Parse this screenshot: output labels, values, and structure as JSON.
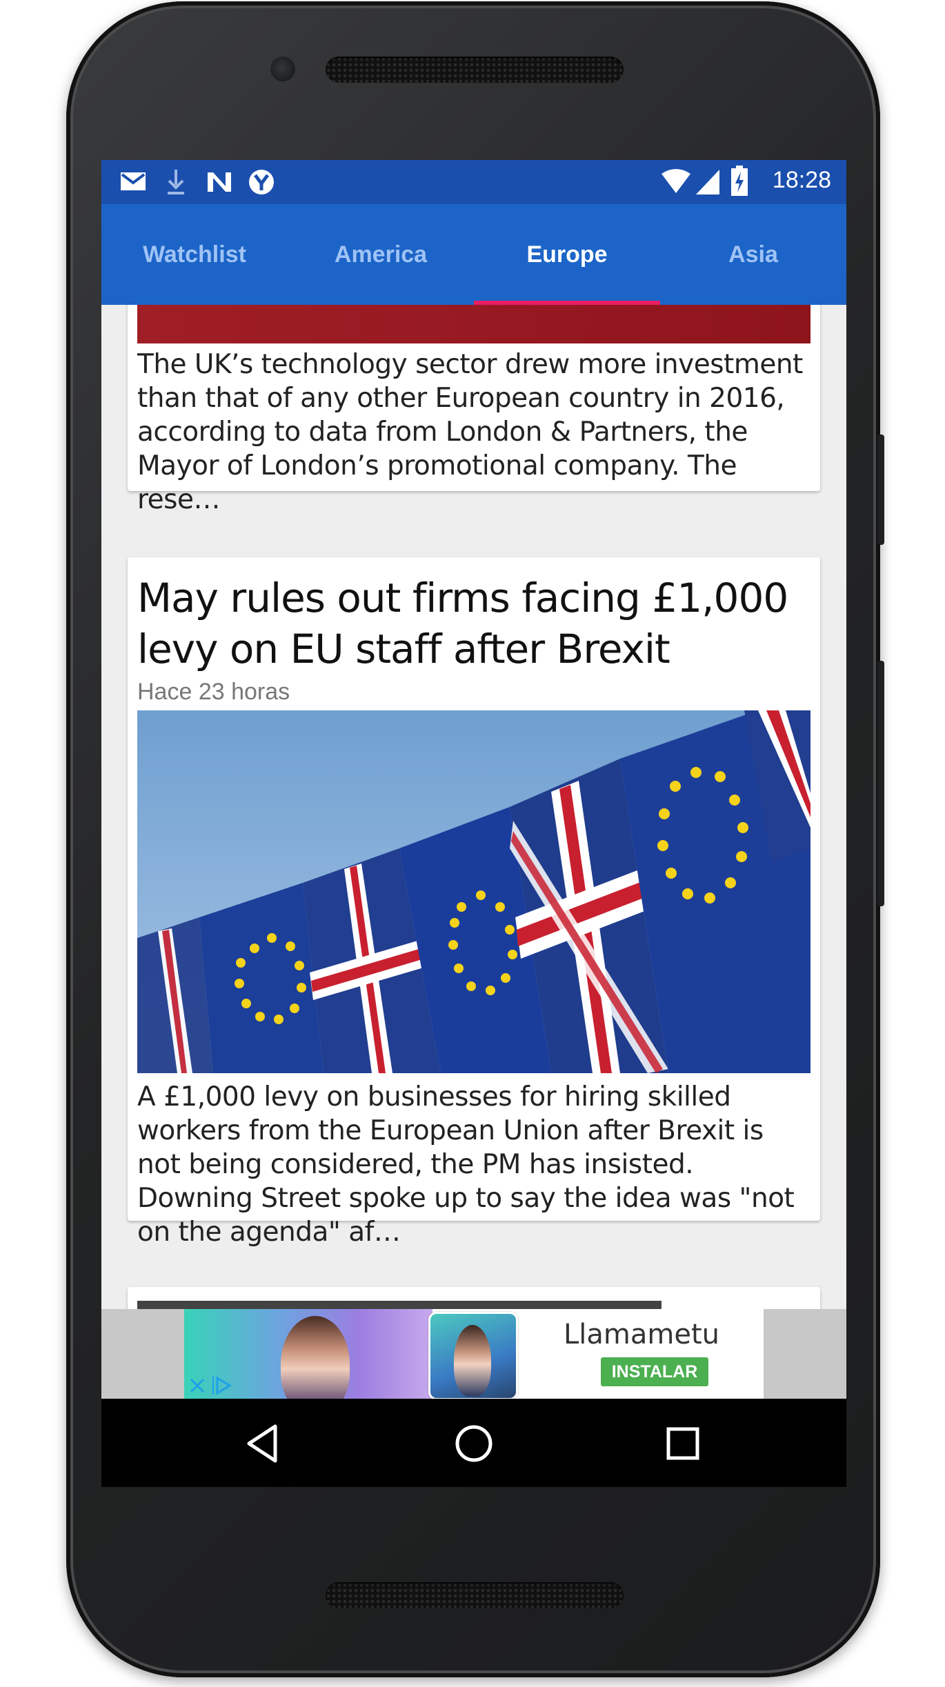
{
  "status_bar": {
    "time": "18:28",
    "left_icons": [
      "gmail-icon",
      "download-icon",
      "n-app-icon",
      "y-app-icon"
    ],
    "right_icons": [
      "wifi-icon",
      "signal-icon",
      "battery-charging-icon"
    ]
  },
  "tabs": [
    {
      "label": "Watchlist",
      "active": false
    },
    {
      "label": "America",
      "active": false
    },
    {
      "label": "Europe",
      "active": true
    },
    {
      "label": "Asia",
      "active": false
    }
  ],
  "colors": {
    "status_bar": "#1b4fae",
    "tab_bar": "#1c64c8",
    "tab_indicator": "#e91e63",
    "install_button": "#4caf50"
  },
  "articles": [
    {
      "summary": "The UK’s technology sector drew more investment than that of any other European country in 2016, according to data from London & Partners, the Mayor of London’s promotional company. The rese…"
    },
    {
      "headline": "May rules out firms facing £1,000 levy on EU staff after Brexit",
      "time": "Hace 23 horas",
      "summary": "A £1,000 levy on businesses for hiring skilled workers from the European Union after Brexit is not being considered, the PM has insisted. Downing Street spoke up to say the idea was \"not on the agenda\" af…"
    }
  ],
  "ad": {
    "app_name": "Llamametu",
    "button_label": "INSTALAR"
  }
}
